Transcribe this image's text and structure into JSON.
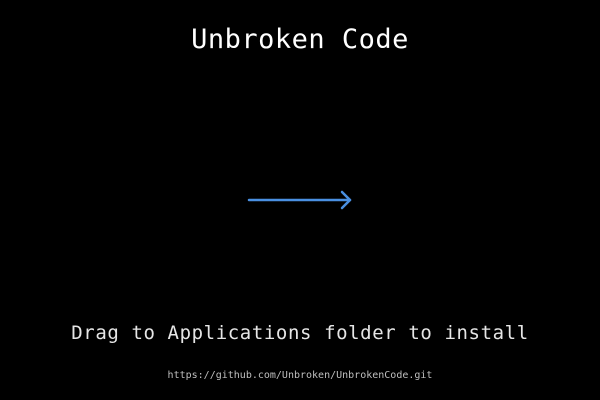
{
  "window": {
    "title": "Unbroken Code",
    "background_color": "#000000"
  },
  "arrow": {
    "icon": "right-arrow-icon",
    "color": "#4a90e2"
  },
  "instruction": {
    "text": "Drag to Applications folder to install"
  },
  "footer": {
    "url": "https://github.com/Unbroken/UnbrokenCode.git"
  }
}
